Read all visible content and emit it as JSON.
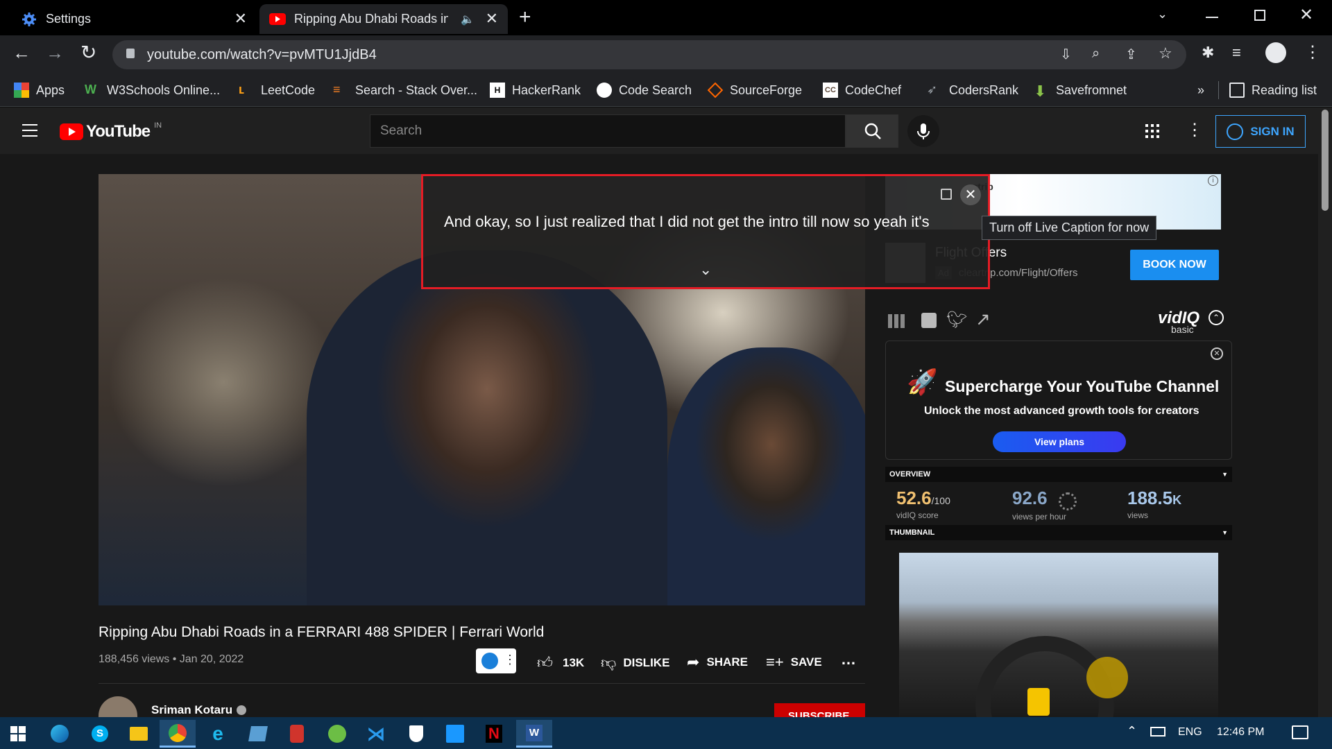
{
  "browser": {
    "tabs": [
      {
        "title": "Settings"
      },
      {
        "title": "Ripping Abu Dhabi Roads in"
      }
    ],
    "url": "youtube.com/watch?v=pvMTU1JjdB4",
    "bookmarks": [
      "Apps",
      "W3Schools Online...",
      "LeetCode",
      "Search - Stack Over...",
      "HackerRank",
      "Code Search",
      "SourceForge",
      "CodeChef",
      "CodersRank",
      "Savefromnet"
    ],
    "more_bookmarks": "»",
    "reading_list": "Reading list"
  },
  "youtube": {
    "logo_text": "YouTube",
    "country": "IN",
    "search_placeholder": "Search",
    "sign_in": "SIGN IN"
  },
  "live_caption": {
    "text": "And okay, so I just realized that I did not get the intro till now so yeah it's",
    "tooltip": "Turn off Live Caption for now"
  },
  "ad": {
    "brand_fragment": "artrip",
    "title": "Flight Offers",
    "badge": "Ad",
    "url": "cleartrip.com/Flight/Offers",
    "cta": "BOOK NOW"
  },
  "video": {
    "title": "Ripping Abu Dhabi Roads in a FERRARI 488 SPIDER | Ferrari World",
    "views_date": "188,456 views • Jan 20, 2022",
    "likes": "13K",
    "dislike": "DISLIKE",
    "share": "SHARE",
    "save": "SAVE",
    "channel": "Sriman Kotaru",
    "subscribe": "SUBSCRIBE"
  },
  "vidiq": {
    "logo": "vidIQ",
    "plan": "basic",
    "promo_title": "Supercharge Your YouTube Channel",
    "promo_subtitle": "Unlock the most advanced growth tools for creators",
    "promo_button": "View plans",
    "overview_label": "OVERVIEW",
    "score": "52.6",
    "score_max": "/100",
    "score_label": "vidIQ score",
    "vph": "92.6",
    "vph_label": "views per hour",
    "views": "188.5",
    "views_suffix": "K",
    "views_label": "views",
    "thumbnail_label": "THUMBNAIL"
  },
  "taskbar": {
    "language": "ENG",
    "time": "12:46 PM"
  },
  "colors": {
    "accent_red": "#e41c25",
    "yt_red": "#ff0000",
    "sign_in_blue": "#3ea6ff",
    "book_now_blue": "#1a8ef0",
    "vidiq_score": "#f0c070",
    "vidiq_vph": "#8aa7c8",
    "vidiq_views": "#a9c8ea"
  }
}
